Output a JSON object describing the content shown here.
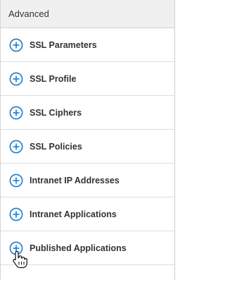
{
  "panel": {
    "title": "Advanced",
    "items": [
      {
        "label": "SSL Parameters",
        "icon": "plus-circle-icon"
      },
      {
        "label": "SSL Profile",
        "icon": "plus-circle-icon"
      },
      {
        "label": "SSL Ciphers",
        "icon": "plus-circle-icon"
      },
      {
        "label": "SSL Policies",
        "icon": "plus-circle-icon"
      },
      {
        "label": "Intranet IP Addresses",
        "icon": "plus-circle-icon"
      },
      {
        "label": "Intranet Applications",
        "icon": "plus-circle-icon"
      },
      {
        "label": "Published Applications",
        "icon": "plus-circle-icon"
      }
    ]
  },
  "colors": {
    "accent": "#1f79c2",
    "header_bg": "#f0f0f0",
    "text": "#333333",
    "divider": "#dcdcdc"
  },
  "cursor": {
    "icon": "hand-pointer-icon"
  }
}
